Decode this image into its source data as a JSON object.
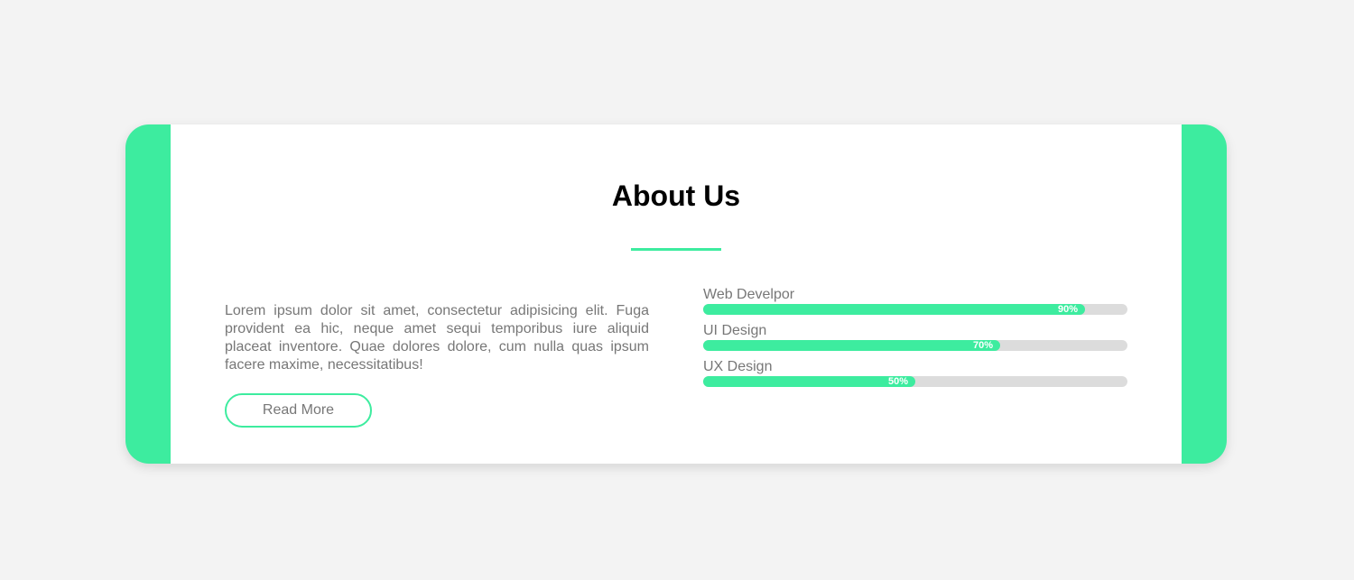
{
  "about": {
    "title": "About Us",
    "paragraph": "Lorem ipsum dolor sit amet, consectetur adipisicing elit. Fuga provident ea hic, neque amet sequi temporibus iure aliquid placeat inventore. Quae dolores dolore, cum nulla quas ipsum facere maxime, necessitatibus!",
    "button_label": "Read More"
  },
  "skills": [
    {
      "label": "Web Develpor",
      "percent": 90,
      "percent_label": "90%"
    },
    {
      "label": "UI Design",
      "percent": 70,
      "percent_label": "70%"
    },
    {
      "label": "UX Design",
      "percent": 50,
      "percent_label": "50%"
    }
  ],
  "colors": {
    "accent": "#3dec9f",
    "track": "#dcdcdc",
    "background": "#f3f3f3",
    "text": "#777777"
  }
}
